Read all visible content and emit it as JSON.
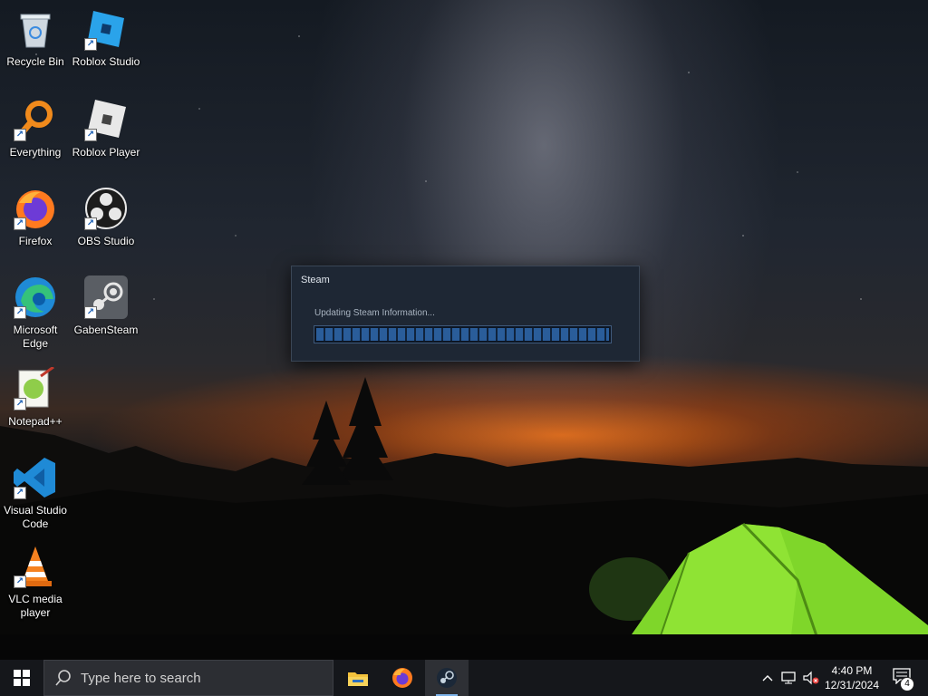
{
  "desktop": {
    "icons": [
      {
        "label": "Recycle Bin",
        "icon": "recycle-bin-icon"
      },
      {
        "label": "Roblox Studio",
        "icon": "roblox-studio-icon"
      },
      {
        "label": "Everything",
        "icon": "everything-search-icon"
      },
      {
        "label": "Roblox Player",
        "icon": "roblox-player-icon"
      },
      {
        "label": "Firefox",
        "icon": "firefox-icon"
      },
      {
        "label": "OBS Studio",
        "icon": "obs-studio-icon"
      },
      {
        "label": "Microsoft Edge",
        "icon": "edge-icon"
      },
      {
        "label": "GabenSteam",
        "icon": "steam-icon"
      },
      {
        "label": "Notepad++",
        "icon": "notepadpp-icon"
      },
      {
        "label": "Visual Studio Code",
        "icon": "vscode-icon"
      },
      {
        "label": "VLC media player",
        "icon": "vlc-icon"
      }
    ]
  },
  "steam_dialog": {
    "title": "Steam",
    "status": "Updating Steam Information...",
    "progress": 1.0
  },
  "taskbar": {
    "search_placeholder": "Type here to search",
    "pinned": [
      {
        "name": "File Explorer",
        "icon": "file-explorer-icon"
      },
      {
        "name": "Firefox",
        "icon": "firefox-icon"
      },
      {
        "name": "Steam",
        "icon": "steam-icon",
        "active": true
      }
    ],
    "clock": {
      "time": "4:40 PM",
      "date": "12/31/2024"
    },
    "notification_count": "4"
  },
  "colors": {
    "taskbar": "#15171b",
    "dialog_bg": "#1e2734",
    "progress": "#2a5d9a",
    "tent": "#7fd62a"
  }
}
